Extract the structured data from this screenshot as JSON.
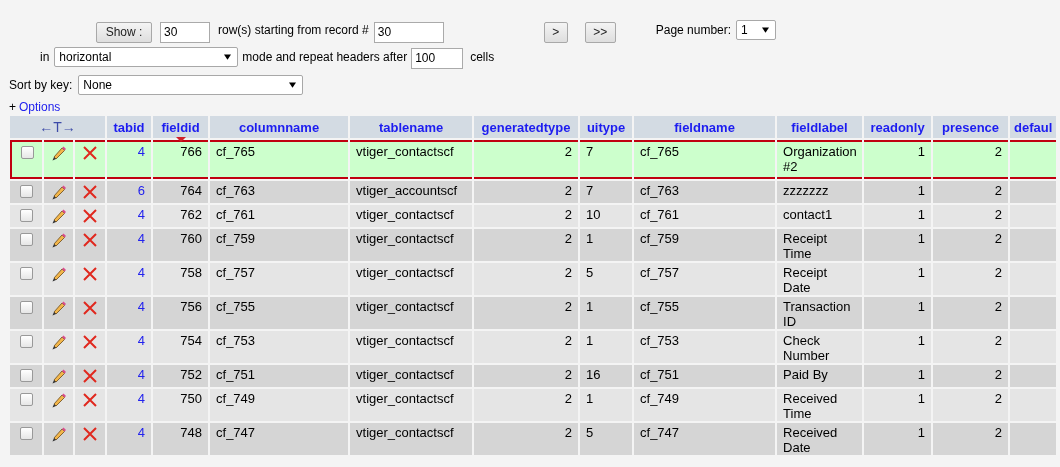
{
  "controls": {
    "show_button": "Show :",
    "row_count": "30",
    "rows_text": "row(s) starting from record #",
    "start_record": "30",
    "next_button": ">",
    "last_button": ">>",
    "page_label": "Page number:",
    "page_select": "1",
    "in_label": "in",
    "mode_select": "horizontal",
    "headers_text": "mode and repeat headers after",
    "headers_every": "100",
    "cells_text": "cells",
    "sort_label": "Sort by key:",
    "sort_select": "None",
    "options_plus": "+",
    "options_link": "Options"
  },
  "table": {
    "actions_header": "←T→",
    "columns": [
      {
        "label": "tabid",
        "sorted": false
      },
      {
        "label": "fieldid",
        "sorted": true
      },
      {
        "label": "columnname",
        "sorted": false
      },
      {
        "label": "tablename",
        "sorted": false
      },
      {
        "label": "generatedtype",
        "sorted": false
      },
      {
        "label": "uitype",
        "sorted": false
      },
      {
        "label": "fieldname",
        "sorted": false
      },
      {
        "label": "fieldlabel",
        "sorted": false
      },
      {
        "label": "readonly",
        "sorted": false
      },
      {
        "label": "presence",
        "sorted": false
      },
      {
        "label": "defaul",
        "sorted": false
      }
    ],
    "rows": [
      {
        "selected": true,
        "checked": false,
        "cells": [
          "4",
          "766",
          "cf_765",
          "vtiger_contactscf",
          "2",
          "7",
          "cf_765",
          "Organization #2",
          "1",
          "2",
          ""
        ]
      },
      {
        "selected": false,
        "checked": false,
        "cells": [
          "6",
          "764",
          "cf_763",
          "vtiger_accountscf",
          "2",
          "7",
          "cf_763",
          "zzzzzzz",
          "1",
          "2",
          ""
        ]
      },
      {
        "selected": false,
        "checked": false,
        "cells": [
          "4",
          "762",
          "cf_761",
          "vtiger_contactscf",
          "2",
          "10",
          "cf_761",
          "contact1",
          "1",
          "2",
          ""
        ]
      },
      {
        "selected": false,
        "checked": false,
        "cells": [
          "4",
          "760",
          "cf_759",
          "vtiger_contactscf",
          "2",
          "1",
          "cf_759",
          "Receipt Time",
          "1",
          "2",
          ""
        ]
      },
      {
        "selected": false,
        "checked": false,
        "cells": [
          "4",
          "758",
          "cf_757",
          "vtiger_contactscf",
          "2",
          "5",
          "cf_757",
          "Receipt Date",
          "1",
          "2",
          ""
        ]
      },
      {
        "selected": false,
        "checked": false,
        "cells": [
          "4",
          "756",
          "cf_755",
          "vtiger_contactscf",
          "2",
          "1",
          "cf_755",
          "Transaction ID",
          "1",
          "2",
          ""
        ]
      },
      {
        "selected": false,
        "checked": false,
        "cells": [
          "4",
          "754",
          "cf_753",
          "vtiger_contactscf",
          "2",
          "1",
          "cf_753",
          "Check Number",
          "1",
          "2",
          ""
        ]
      },
      {
        "selected": false,
        "checked": false,
        "cells": [
          "4",
          "752",
          "cf_751",
          "vtiger_contactscf",
          "2",
          "16",
          "cf_751",
          "Paid By",
          "1",
          "2",
          ""
        ]
      },
      {
        "selected": false,
        "checked": false,
        "cells": [
          "4",
          "750",
          "cf_749",
          "vtiger_contactscf",
          "2",
          "1",
          "cf_749",
          "Received Time",
          "1",
          "2",
          ""
        ]
      },
      {
        "selected": false,
        "checked": false,
        "cells": [
          "4",
          "748",
          "cf_747",
          "vtiger_contactscf",
          "2",
          "5",
          "cf_747",
          "Received Date",
          "1",
          "2",
          ""
        ]
      }
    ]
  }
}
